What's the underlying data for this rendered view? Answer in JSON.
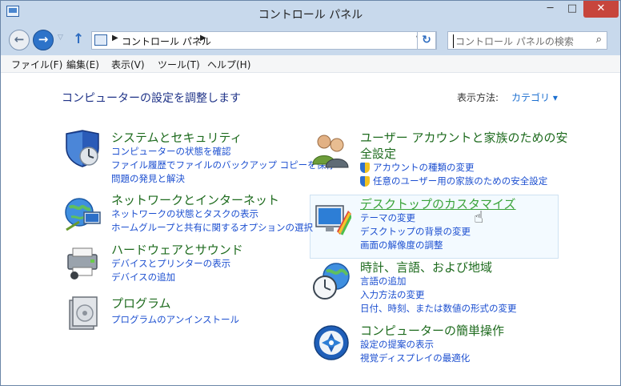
{
  "window": {
    "title": "コントロール パネル",
    "minimize": "─",
    "maximize": "□",
    "close": "✕"
  },
  "address": {
    "breadcrumb": "コントロール パネル",
    "separator": "▶",
    "dropdown": "∨",
    "refresh": "↻"
  },
  "search": {
    "placeholder": "コントロール パネルの検索",
    "icon": "search-icon"
  },
  "nav": {
    "back": "←",
    "forward": "→",
    "history": "▽",
    "up": "↑"
  },
  "menu": [
    "ファイル(F)",
    "編集(E)",
    "表示(V)",
    "ツール(T)",
    "ヘルプ(H)"
  ],
  "main": {
    "heading": "コンピューターの設定を調整します",
    "view_label": "表示方法:",
    "view_value": "カテゴリ ▾"
  },
  "categories": {
    "system": {
      "title": "システムとセキュリティ",
      "links": [
        "コンピューターの状態を確認",
        "ファイル履歴でファイルのバックアップ コピーを保存",
        "問題の発見と解決"
      ]
    },
    "network": {
      "title": "ネットワークとインターネット",
      "links": [
        "ネットワークの状態とタスクの表示",
        "ホームグループと共有に関するオプションの選択"
      ]
    },
    "hardware": {
      "title": "ハードウェアとサウンド",
      "links": [
        "デバイスとプリンターの表示",
        "デバイスの追加"
      ]
    },
    "programs": {
      "title": "プログラム",
      "links": [
        "プログラムのアンインストール"
      ]
    },
    "users": {
      "title_line1": "ユーザー アカウントと家族のための安",
      "title_line2": "全設定",
      "links": [
        "アカウントの種類の変更",
        "任意のユーザー用の家族のための安全設定"
      ]
    },
    "desktop": {
      "title": "デスクトップのカスタマイズ",
      "links": [
        "テーマの変更",
        "デスクトップの背景の変更",
        "画面の解像度の調整"
      ]
    },
    "clock": {
      "title": "時計、言語、および地域",
      "links": [
        "言語の追加",
        "入力方法の変更",
        "日付、時刻、または数値の形式の変更"
      ]
    },
    "ease": {
      "title": "コンピューターの簡単操作",
      "links": [
        "設定の提案の表示",
        "視覚ディスプレイの最適化"
      ]
    }
  }
}
